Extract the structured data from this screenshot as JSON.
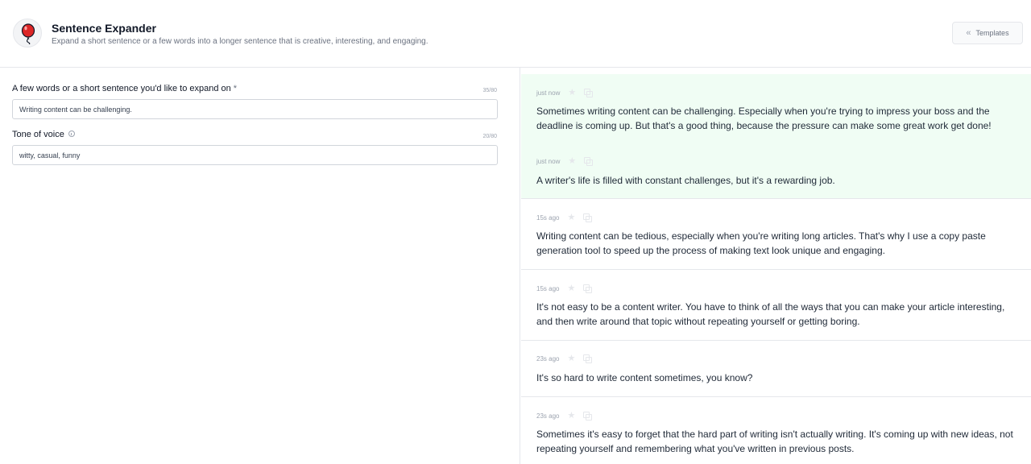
{
  "app": {
    "title": "Sentence Expander",
    "subtitle": "Expand a short sentence or a few words into a longer sentence that is creative, interesting, and engaging.",
    "templates_label": "Templates",
    "brand_color": "#dc2626"
  },
  "form": {
    "field1": {
      "label": "A few words or a short sentence you'd like to expand on",
      "required_mark": "*",
      "counter": "35/80",
      "value": "Writing content can be challenging."
    },
    "field2": {
      "label": "Tone of voice",
      "counter": "20/80",
      "value": "witty, casual, funny"
    }
  },
  "results": [
    {
      "time": "just now",
      "text": "Sometimes writing content can be challenging. Especially when you're trying to impress your boss and the deadline is coming up. But that's a good thing, because the pressure can make some great work get done!"
    },
    {
      "time": "just now",
      "text": "A writer's life is filled with constant challenges, but it's a rewarding job."
    },
    {
      "time": "15s ago",
      "text": "Writing content can be tedious, especially when you're writing long articles. That's why I use a copy paste generation tool to speed up the process of making text look unique and engaging."
    },
    {
      "time": "15s ago",
      "text": "It's not easy to be a content writer. You have to think of all the ways that you can make your article interesting, and then write around that topic without repeating yourself or getting boring."
    },
    {
      "time": "23s ago",
      "text": "It's so hard to write content sometimes, you know?"
    },
    {
      "time": "23s ago",
      "text": "Sometimes it's easy to forget that the hard part of writing isn't actually writing. It's coming up with new ideas, not repeating yourself and remembering what you've written in previous posts."
    }
  ]
}
